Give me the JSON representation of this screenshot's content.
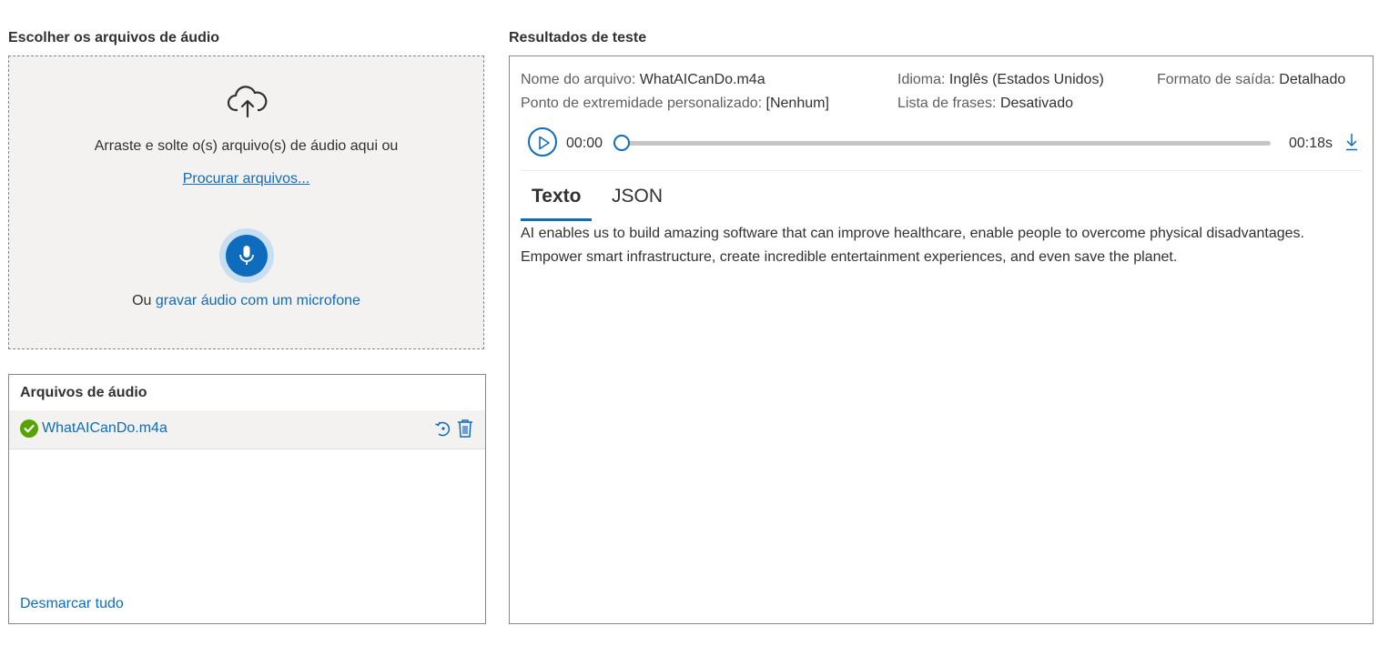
{
  "left": {
    "title": "Escolher os arquivos de áudio",
    "dropzone": {
      "icon": "cloud-upload-icon",
      "text": "Arraste e solte o(s) arquivo(s) de áudio aqui ou",
      "browse_link": "Procurar arquivos...",
      "mic_icon": "microphone-icon",
      "record_prefix": "Ou",
      "record_link": "gravar áudio com um microfone"
    },
    "files": {
      "title": "Arquivos de áudio",
      "items": [
        {
          "name": "WhatAICanDo.m4a",
          "status_icon": "check-circle-icon"
        }
      ],
      "deselect_all": "Desmarcar tudo"
    }
  },
  "results": {
    "title": "Resultados de teste",
    "meta": {
      "file_label": "Nome do arquivo:",
      "file_value": "WhatAICanDo.m4a",
      "language_label": "Idioma:",
      "language_value": "Inglês (Estados Unidos)",
      "format_label": "Formato de saída:",
      "format_value": "Detalhado",
      "endpoint_label": "Ponto de extremidade personalizado:",
      "endpoint_value": "[Nenhum]",
      "phrases_label": "Lista de frases:",
      "phrases_value": "Desativado"
    },
    "player": {
      "current_time": "00:00",
      "total_time": "00:18s",
      "progress": 0
    },
    "tabs": [
      {
        "label": "Texto",
        "selected": true
      },
      {
        "label": "JSON",
        "selected": false
      }
    ],
    "transcript": "AI enables us to build amazing software that can improve healthcare, enable people to overcome physical disadvantages. Empower smart infrastructure, create incredible entertainment experiences, and even save the planet."
  },
  "colors": {
    "accent": "#0f6cbd",
    "success": "#57a300",
    "dropzone_bg": "#f3f2f1"
  }
}
